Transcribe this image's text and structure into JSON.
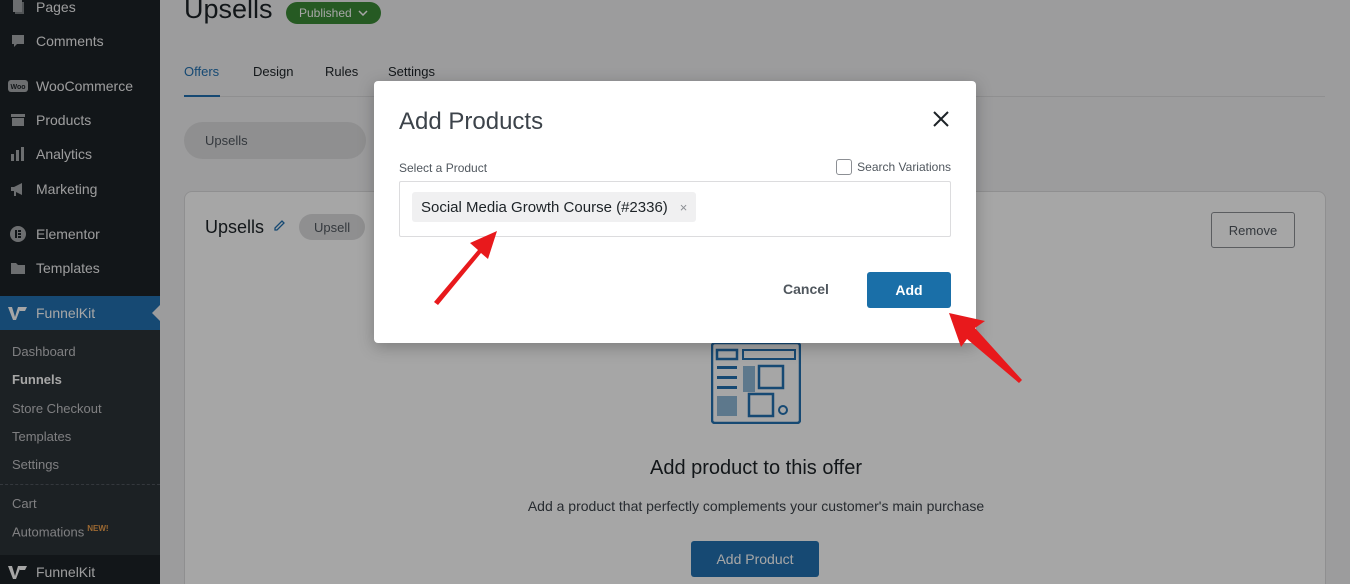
{
  "sidebar": {
    "items": [
      {
        "label": "Pages",
        "icon": "pages-icon"
      },
      {
        "label": "Comments",
        "icon": "comments-icon"
      },
      {
        "label": "WooCommerce",
        "icon": "woocommerce-icon"
      },
      {
        "label": "Products",
        "icon": "products-icon"
      },
      {
        "label": "Analytics",
        "icon": "analytics-icon"
      },
      {
        "label": "Marketing",
        "icon": "marketing-icon"
      },
      {
        "label": "Elementor",
        "icon": "elementor-icon"
      },
      {
        "label": "Templates",
        "icon": "templates-icon"
      },
      {
        "label": "FunnelKit",
        "icon": "funnelkit-icon"
      }
    ],
    "submenu": [
      {
        "label": "Dashboard"
      },
      {
        "label": "Funnels"
      },
      {
        "label": "Store Checkout"
      },
      {
        "label": "Templates"
      },
      {
        "label": "Settings"
      },
      {
        "label": "Cart"
      },
      {
        "label": "Automations",
        "badge": "NEW!"
      }
    ],
    "bottom_item": {
      "label": "FunnelKit",
      "icon": "funnelkit-icon"
    }
  },
  "page": {
    "title": "Upsells",
    "status": "Published",
    "tabs": [
      {
        "label": "Offers"
      },
      {
        "label": "Design"
      },
      {
        "label": "Rules"
      },
      {
        "label": "Settings"
      }
    ],
    "offer_pill": "Upsells",
    "card": {
      "title": "Upsells",
      "type_badge": "Upsell",
      "remove_label": "Remove",
      "empty_title": "Add product to this offer",
      "empty_desc": "Add a product that perfectly complements your customer's main purchase",
      "add_product_label": "Add Product"
    }
  },
  "modal": {
    "title": "Add Products",
    "field_label": "Select a Product",
    "variations_label": "Search Variations",
    "selected_chip": "Social Media Growth Course (#2336)",
    "chip_remove": "×",
    "cancel_label": "Cancel",
    "add_label": "Add"
  },
  "colors": {
    "sidebar_bg": "#1d2327",
    "active_menu": "#2271b1",
    "published_badge": "#3b8a36",
    "primary_button": "#1a6fa8",
    "annotation_arrow": "#e8191c"
  }
}
